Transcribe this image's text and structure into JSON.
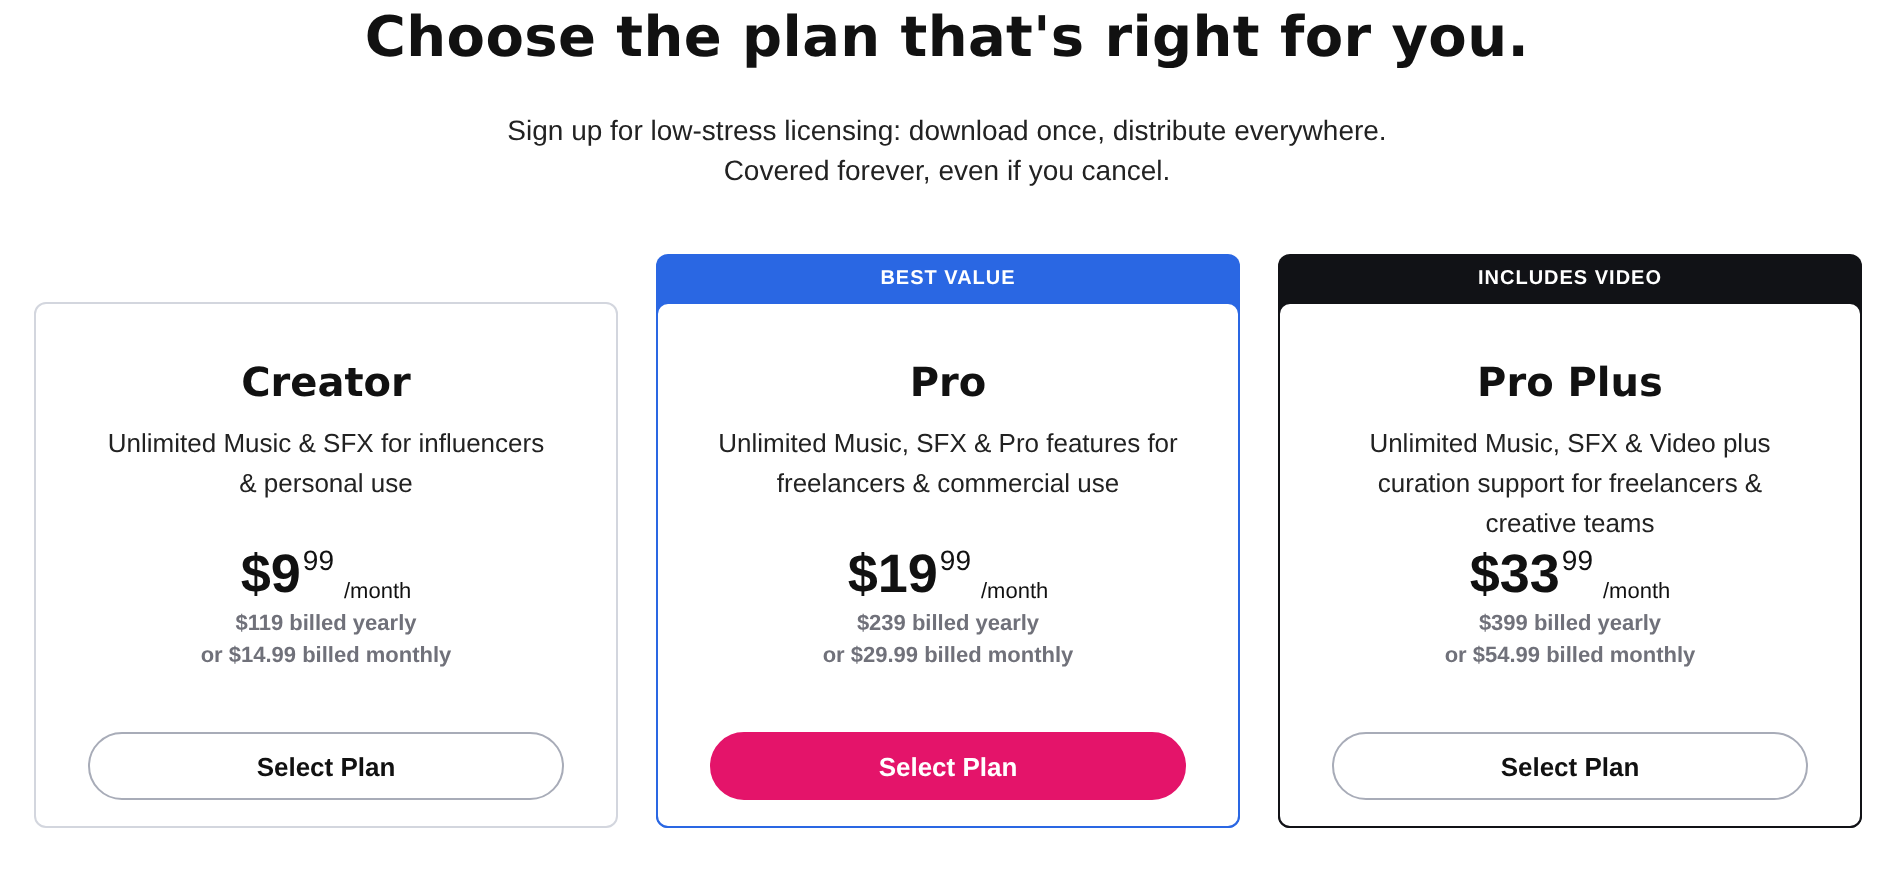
{
  "heading": "Choose the plan that's right for you.",
  "subtitle_lines": [
    "Sign up for low-stress licensing: download once, distribute everywhere.",
    "Covered forever, even if you cancel."
  ],
  "plans": [
    {
      "name": "Creator",
      "description": "Unlimited Music & SFX for influencers & personal use",
      "price_whole": "$9",
      "price_cents": "99",
      "period": "/month",
      "yearly": "$119 billed yearly",
      "monthly": "or $14.99 billed monthly",
      "button": "Select Plan",
      "featured": false
    },
    {
      "name": "Pro",
      "banner": {
        "text": "BEST VALUE",
        "color": "#2a67e3"
      },
      "description": "Unlimited Music, SFX & Pro features for freelancers & commercial use",
      "price_whole": "$19",
      "price_cents": "99",
      "period": "/month",
      "yearly": "$239 billed yearly",
      "monthly": "or $29.99 billed monthly",
      "button": "Select Plan",
      "featured": true
    },
    {
      "name": "Pro Plus",
      "banner": {
        "text": "INCLUDES VIDEO",
        "color": "#111216"
      },
      "description": "Unlimited Music, SFX & Video plus curation support for freelancers & creative teams",
      "price_whole": "$33",
      "price_cents": "99",
      "period": "/month",
      "yearly": "$399 billed yearly",
      "monthly": "or $54.99 billed monthly",
      "button": "Select Plan",
      "featured": false
    }
  ]
}
